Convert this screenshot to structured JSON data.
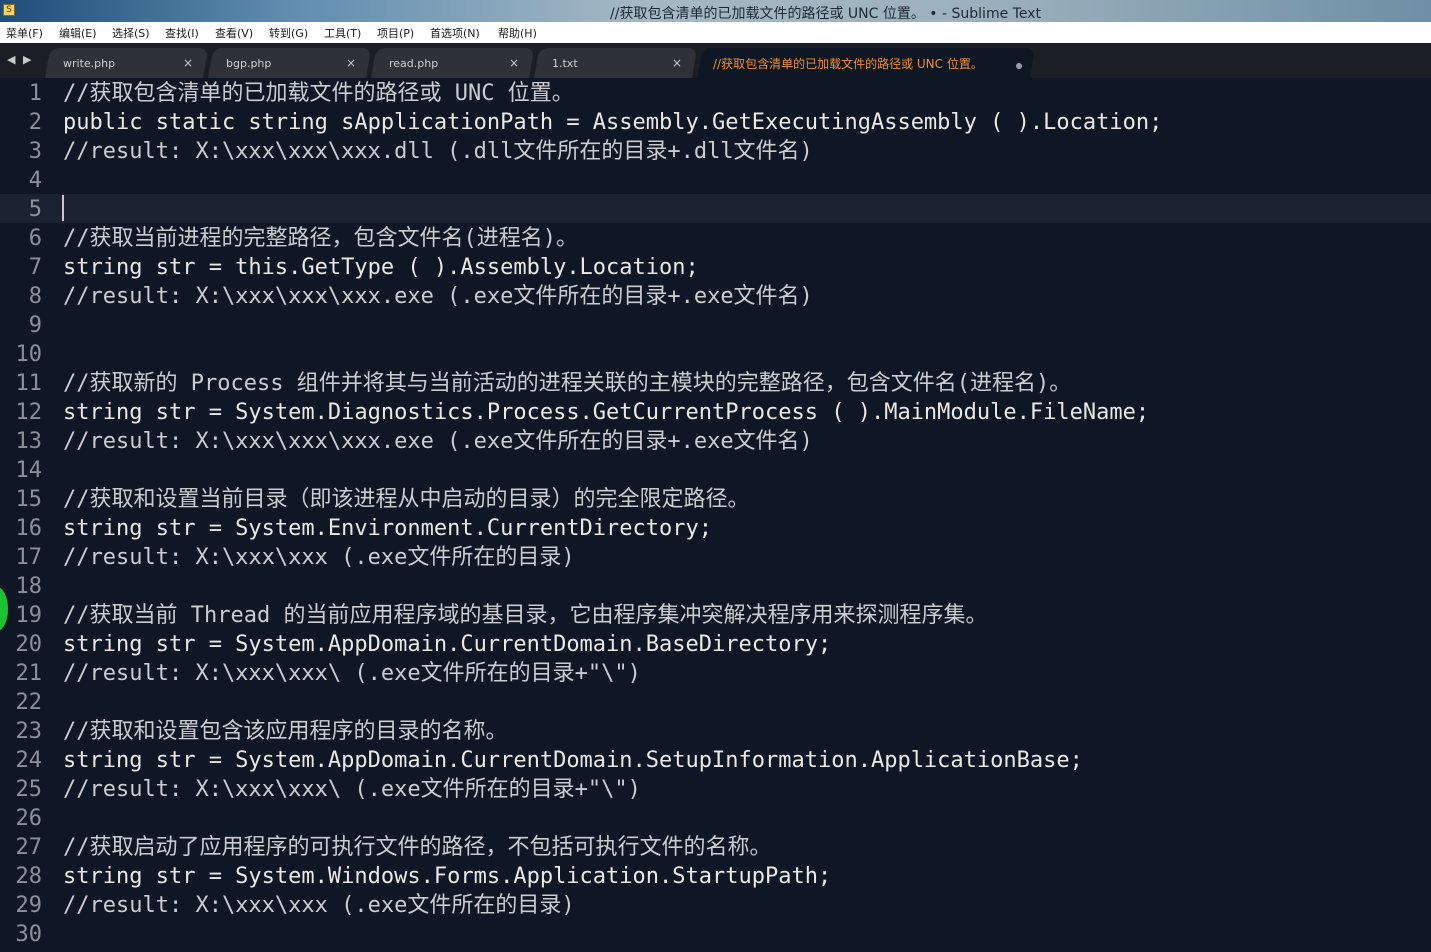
{
  "window": {
    "title": "//获取包含清单的已加载文件的路径或 UNC 位置。 • - Sublime Text",
    "app_icon": "sublime-app-icon"
  },
  "menu": [
    "菜单(F)",
    "编辑(E)",
    "选择(S)",
    "查找(I)",
    "查看(V)",
    "转到(G)",
    "工具(T)",
    "项目(P)",
    "首选项(N)",
    "帮助(H)"
  ],
  "tabs": [
    {
      "label": "write.php",
      "active": false
    },
    {
      "label": "bgp.php",
      "active": false
    },
    {
      "label": "read.php",
      "active": false
    },
    {
      "label": "1.txt",
      "active": false
    },
    {
      "label": "//获取包含清单的已加载文件的路径或 UNC 位置。",
      "active": true,
      "dirty": true
    }
  ],
  "nav": {
    "back_icon": "triangle-left-icon",
    "forward_icon": "triangle-right-icon"
  },
  "colors": {
    "background": "#0f1624",
    "active_tab_text": "#f08d2c",
    "line_numbers": "#8b9099",
    "current_line": "#1b2231"
  },
  "editor": {
    "current_line": 5,
    "lines": [
      {
        "n": "1",
        "text": "//获取包含清单的已加载文件的路径或 UNC 位置。"
      },
      {
        "n": "2",
        "text": "public static string sApplicationPath = Assembly.GetExecutingAssembly ( ).Location;"
      },
      {
        "n": "3",
        "text": "//result: X:\\xxx\\xxx\\xxx.dll (.dll文件所在的目录+.dll文件名)"
      },
      {
        "n": "4",
        "text": ""
      },
      {
        "n": "5",
        "text": ""
      },
      {
        "n": "6",
        "text": "//获取当前进程的完整路径，包含文件名(进程名)。"
      },
      {
        "n": "7",
        "text": "string str = this.GetType ( ).Assembly.Location;"
      },
      {
        "n": "8",
        "text": "//result: X:\\xxx\\xxx\\xxx.exe (.exe文件所在的目录+.exe文件名)"
      },
      {
        "n": "9",
        "text": ""
      },
      {
        "n": "10",
        "text": ""
      },
      {
        "n": "11",
        "text": "//获取新的 Process 组件并将其与当前活动的进程关联的主模块的完整路径，包含文件名(进程名)。"
      },
      {
        "n": "12",
        "text": "string str = System.Diagnostics.Process.GetCurrentProcess ( ).MainModule.FileName;"
      },
      {
        "n": "13",
        "text": "//result: X:\\xxx\\xxx\\xxx.exe (.exe文件所在的目录+.exe文件名)"
      },
      {
        "n": "14",
        "text": ""
      },
      {
        "n": "15",
        "text": "//获取和设置当前目录（即该进程从中启动的目录）的完全限定路径。"
      },
      {
        "n": "16",
        "text": "string str = System.Environment.CurrentDirectory;"
      },
      {
        "n": "17",
        "text": "//result: X:\\xxx\\xxx (.exe文件所在的目录)"
      },
      {
        "n": "18",
        "text": ""
      },
      {
        "n": "19",
        "text": "//获取当前 Thread 的当前应用程序域的基目录，它由程序集冲突解决程序用来探测程序集。"
      },
      {
        "n": "20",
        "text": "string str = System.AppDomain.CurrentDomain.BaseDirectory;"
      },
      {
        "n": "21",
        "text": "//result: X:\\xxx\\xxx\\ (.exe文件所在的目录+\"\\\")"
      },
      {
        "n": "22",
        "text": ""
      },
      {
        "n": "23",
        "text": "//获取和设置包含该应用程序的目录的名称。"
      },
      {
        "n": "24",
        "text": "string str = System.AppDomain.CurrentDomain.SetupInformation.ApplicationBase;"
      },
      {
        "n": "25",
        "text": "//result: X:\\xxx\\xxx\\ (.exe文件所在的目录+\"\\\")"
      },
      {
        "n": "26",
        "text": ""
      },
      {
        "n": "27",
        "text": "//获取启动了应用程序的可执行文件的路径，不包括可执行文件的名称。"
      },
      {
        "n": "28",
        "text": "string str = System.Windows.Forms.Application.StartupPath;"
      },
      {
        "n": "29",
        "text": "//result: X:\\xxx\\xxx (.exe文件所在的目录)"
      },
      {
        "n": "30",
        "text": ""
      }
    ]
  }
}
